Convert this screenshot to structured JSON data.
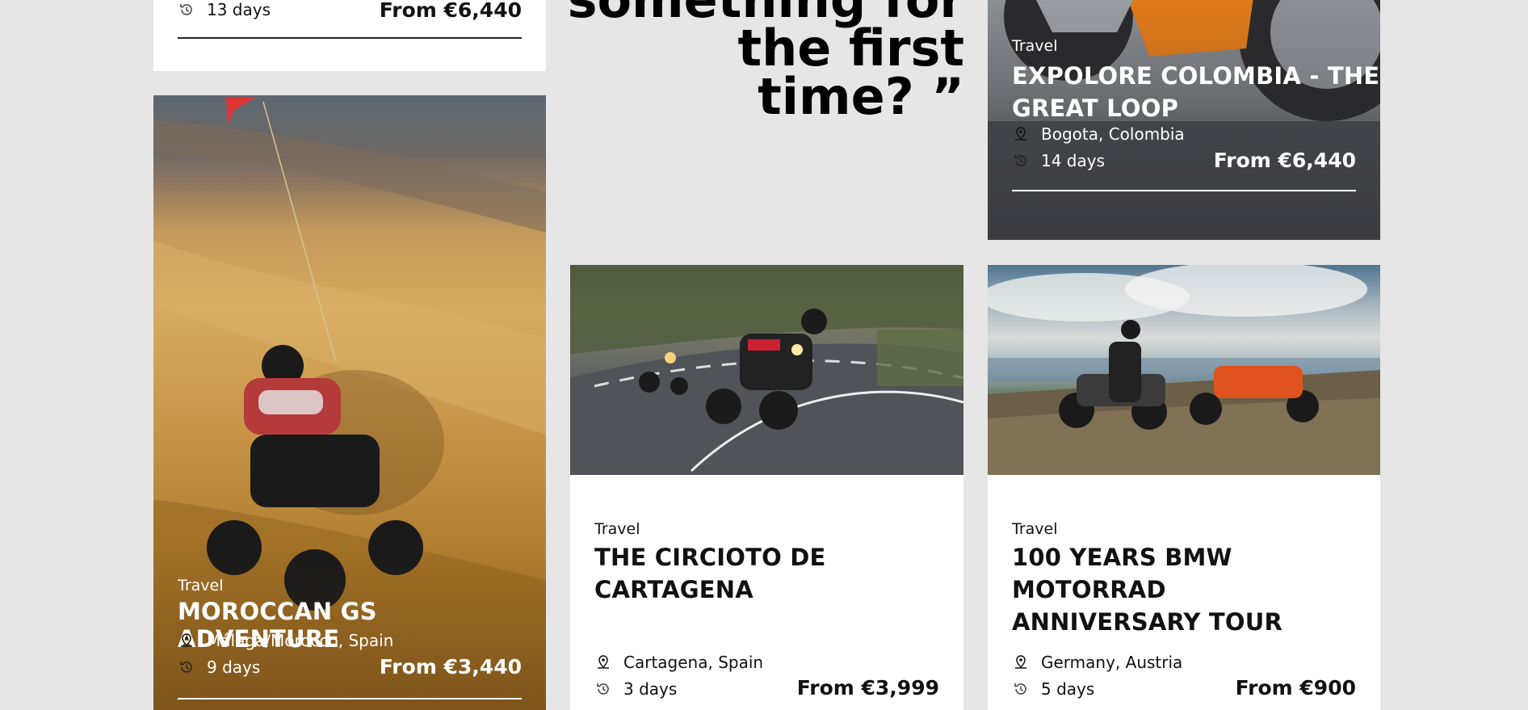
{
  "quote": {
    "line1": "something for",
    "line2": "the first time? ”"
  },
  "cards": {
    "top_left": {
      "duration": "13 days",
      "price": "From €6,440"
    },
    "morocco": {
      "category": "Travel",
      "title": "MOROCCAN GS ADVENTURE",
      "location": "Málaga/Morocco, Spain",
      "duration": "9 days",
      "price": "From €3,440"
    },
    "colombia": {
      "category": "Travel",
      "title_line1": "EXPOLORE COLOMBIA - THE",
      "title_line2": "GREAT LOOP",
      "location": "Bogota, Colombia",
      "duration": "14 days",
      "price": "From €6,440"
    },
    "cartagena": {
      "category": "Travel",
      "title_line1": "THE CIRCIOTO DE",
      "title_line2": "CARTAGENA",
      "location": "Cartagena, Spain",
      "duration": "3 days",
      "price": "From €3,999"
    },
    "bmw": {
      "category": "Travel",
      "title_line1": "100 YEARS BMW MOTORRAD",
      "title_line2": "ANNIVERSARY TOUR",
      "location": "Germany, Austria",
      "duration": "5 days",
      "price": "From €900"
    }
  },
  "icons": {
    "location": "location-pin-icon",
    "duration": "clock-history-icon"
  },
  "colors": {
    "page_bg": "#e6e6e6",
    "card_bg": "#ffffff",
    "text": "#111111"
  }
}
